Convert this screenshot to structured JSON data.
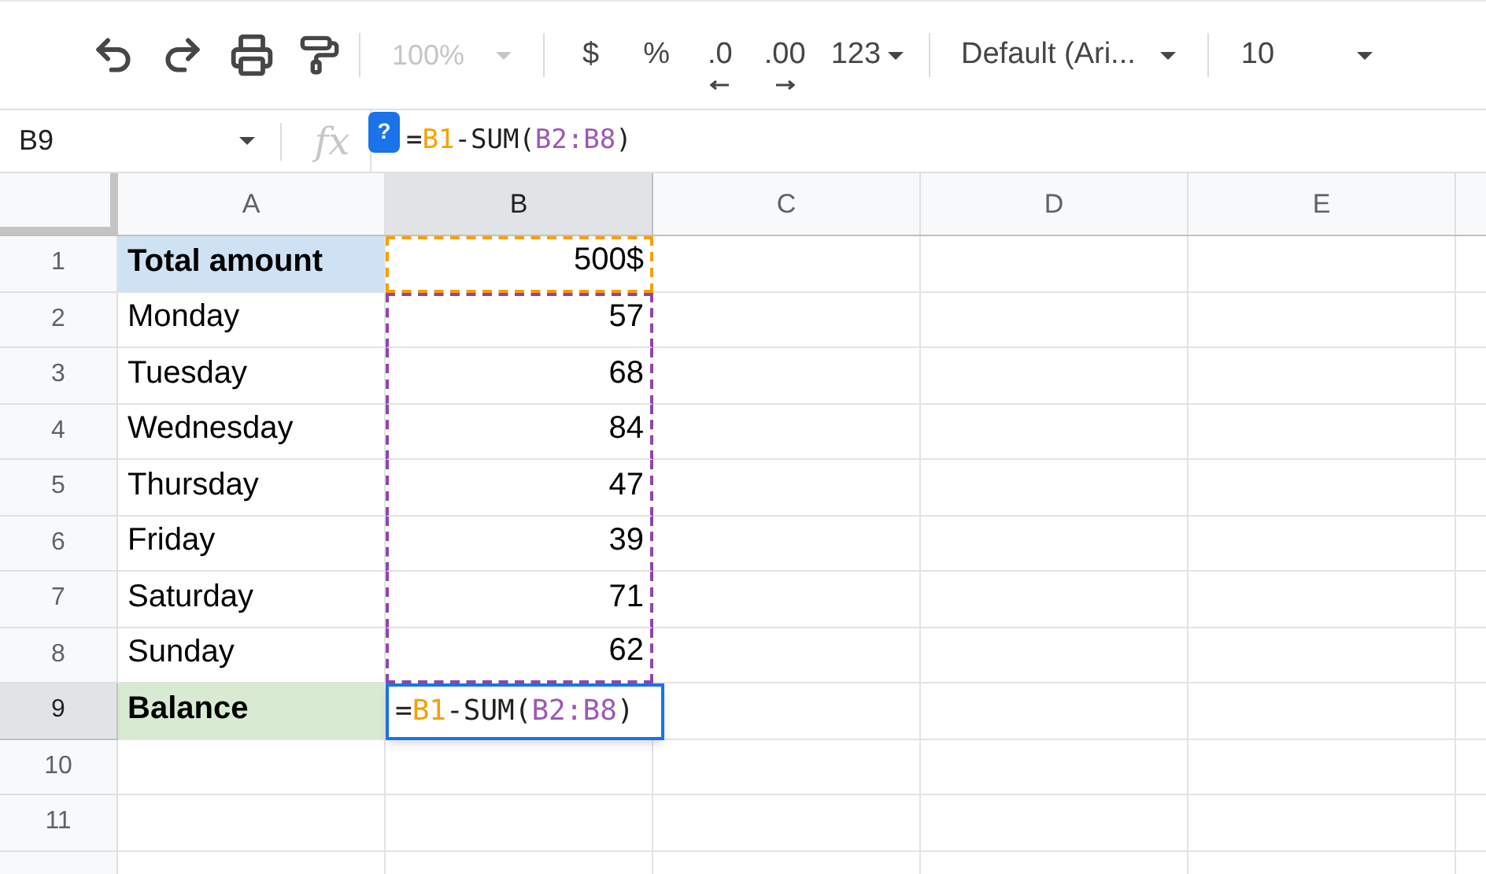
{
  "toolbar": {
    "zoom": {
      "label": "100%",
      "disabled": true
    },
    "format_buttons": [
      {
        "label": "$",
        "kind": "plain"
      },
      {
        "label": "%",
        "kind": "plain"
      },
      {
        "label": ".0",
        "kind": "decrease"
      },
      {
        "label": ".00",
        "kind": "increase"
      },
      {
        "label": "123",
        "kind": "menu"
      }
    ],
    "font": "Default (Ari...",
    "font_size": "10"
  },
  "formula_bar": {
    "cell_ref": "B9",
    "fx": "fx",
    "help": "?",
    "formula": [
      {
        "text": "=",
        "color": "#202124"
      },
      {
        "text": "B1",
        "color": "#f6a000"
      },
      {
        "text": "-SUM(",
        "color": "#202124"
      },
      {
        "text": "B2:B8",
        "color": "#9b59b6"
      },
      {
        "text": ")",
        "color": "#202124"
      }
    ]
  },
  "columns": [
    {
      "label": "A",
      "selected": false
    },
    {
      "label": "B",
      "selected": true
    },
    {
      "label": "C",
      "selected": false
    },
    {
      "label": "D",
      "selected": false
    },
    {
      "label": "E",
      "selected": false
    }
  ],
  "rows": [
    {
      "number": "1",
      "selected": false,
      "a": {
        "text": "Total amount",
        "bold": true,
        "color": "#cfe2f3"
      },
      "b": {
        "text": "500$",
        "color": "#f6a000"
      }
    },
    {
      "number": "2",
      "selected": false,
      "a": {
        "text": "Monday",
        "bold": false
      },
      "b": {
        "text": "57",
        "color": "#8e44ad"
      }
    },
    {
      "number": "3",
      "selected": false,
      "a": {
        "text": "Tuesday",
        "bold": false
      },
      "b": {
        "text": "68",
        "color": "#8e44ad"
      }
    },
    {
      "number": "4",
      "selected": false,
      "a": {
        "text": "Wednesday",
        "bold": false
      },
      "b": {
        "text": "84",
        "color": "#8e44ad"
      }
    },
    {
      "number": "5",
      "selected": false,
      "a": {
        "text": "Thursday",
        "bold": false
      },
      "b": {
        "text": "47",
        "color": "#8e44ad"
      }
    },
    {
      "number": "6",
      "selected": false,
      "a": {
        "text": "Friday",
        "bold": false
      },
      "b": {
        "text": "39",
        "color": "#8e44ad"
      }
    },
    {
      "number": "7",
      "selected": false,
      "a": {
        "text": "Saturday",
        "bold": false
      },
      "b": {
        "text": "71",
        "color": "#8e44ad"
      }
    },
    {
      "number": "8",
      "selected": false,
      "a": {
        "text": "Sunday",
        "bold": false
      },
      "b": {
        "text": "62",
        "color": "#8e44ad"
      }
    },
    {
      "number": "9",
      "selected": true,
      "a": {
        "text": "Balance",
        "bold": true,
        "color": "#d9ead3"
      },
      "b": {
        "editing": true,
        "formula": [
          {
            "text": "=",
            "color": "#202124"
          },
          {
            "text": "B1",
            "color": "#f6a000"
          },
          {
            "text": "-SUM(",
            "color": "#202124"
          },
          {
            "text": "B2:B8",
            "color": "#9b59b6"
          },
          {
            "text": ")",
            "color": "#202124"
          }
        ]
      }
    },
    {
      "number": "10",
      "selected": false
    },
    {
      "number": "11",
      "selected": false
    }
  ]
}
